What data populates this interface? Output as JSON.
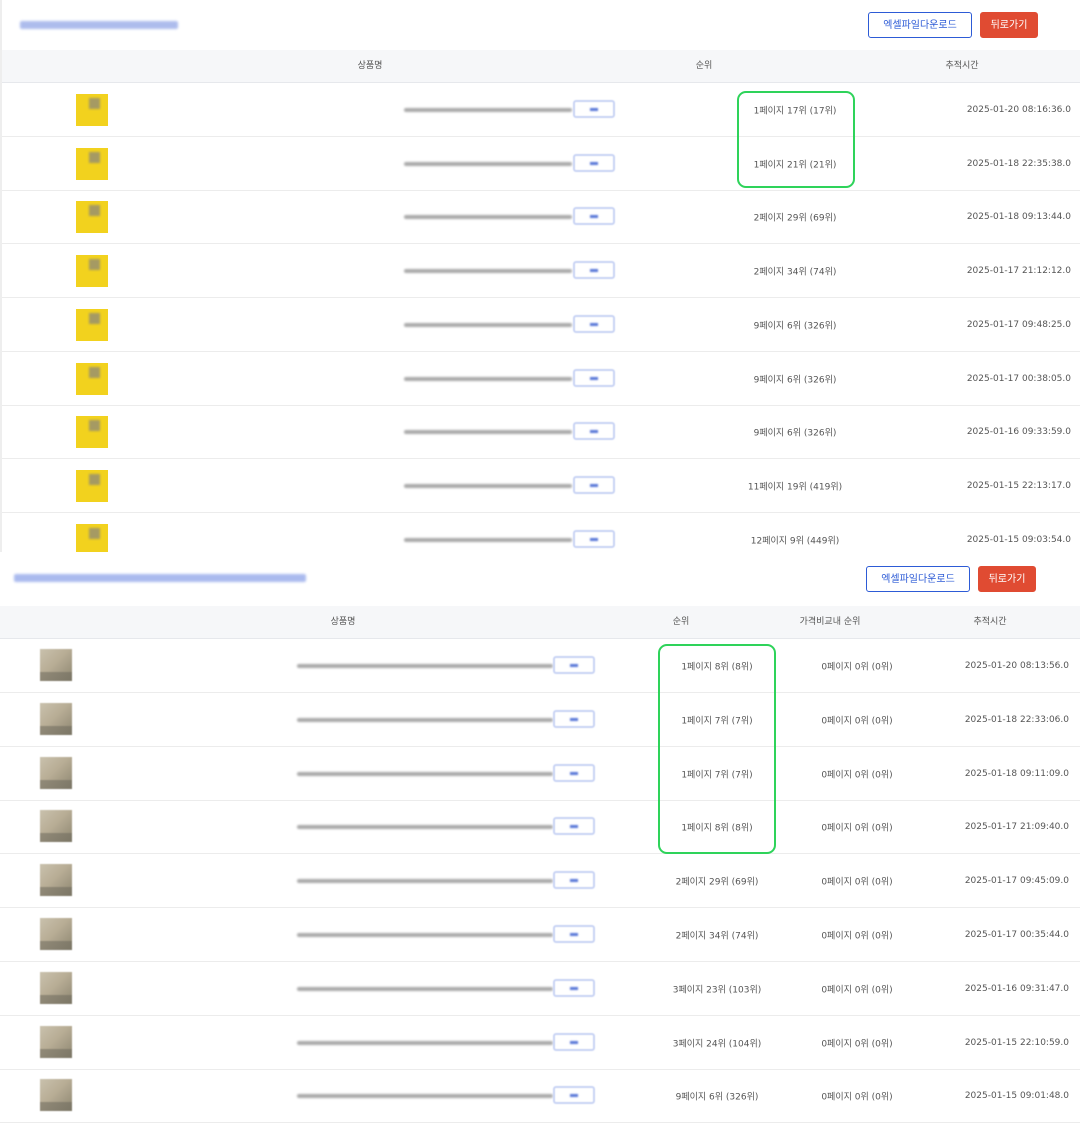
{
  "panel1": {
    "buttons": {
      "excel": "엑셀파일다운로드",
      "back": "뒤로가기"
    },
    "headers": {
      "product": "상품명",
      "rank": "순위",
      "time": "추적시간"
    },
    "rows": [
      {
        "rank": "1페이지 17위 (17위)",
        "time": "2025-01-20 08:16:36.0"
      },
      {
        "rank": "1페이지 21위 (21위)",
        "time": "2025-01-18 22:35:38.0"
      },
      {
        "rank": "2페이지 29위 (69위)",
        "time": "2025-01-18 09:13:44.0"
      },
      {
        "rank": "2페이지 34위 (74위)",
        "time": "2025-01-17 21:12:12.0"
      },
      {
        "rank": "9페이지 6위 (326위)",
        "time": "2025-01-17 09:48:25.0"
      },
      {
        "rank": "9페이지 6위 (326위)",
        "time": "2025-01-17 00:38:05.0"
      },
      {
        "rank": "9페이지 6위 (326위)",
        "time": "2025-01-16 09:33:59.0"
      },
      {
        "rank": "11페이지 19위 (419위)",
        "time": "2025-01-15 22:13:17.0"
      },
      {
        "rank": "12페이지 9위 (449위)",
        "time": "2025-01-15 09:03:54.0"
      }
    ]
  },
  "panel2": {
    "buttons": {
      "excel": "엑셀파일다운로드",
      "back": "뒤로가기"
    },
    "headers": {
      "product": "상품명",
      "rank": "순위",
      "compare_rank": "가격비교내 순위",
      "time": "추적시간"
    },
    "rows": [
      {
        "rank": "1페이지 8위 (8위)",
        "compare": "0페이지 0위 (0위)",
        "time": "2025-01-20 08:13:56.0"
      },
      {
        "rank": "1페이지 7위 (7위)",
        "compare": "0페이지 0위 (0위)",
        "time": "2025-01-18 22:33:06.0"
      },
      {
        "rank": "1페이지 7위 (7위)",
        "compare": "0페이지 0위 (0위)",
        "time": "2025-01-18 09:11:09.0"
      },
      {
        "rank": "1페이지 8위 (8위)",
        "compare": "0페이지 0위 (0위)",
        "time": "2025-01-17 21:09:40.0"
      },
      {
        "rank": "2페이지 29위 (69위)",
        "compare": "0페이지 0위 (0위)",
        "time": "2025-01-17 09:45:09.0"
      },
      {
        "rank": "2페이지 34위 (74위)",
        "compare": "0페이지 0위 (0위)",
        "time": "2025-01-17 00:35:44.0"
      },
      {
        "rank": "3페이지 23위 (103위)",
        "compare": "0페이지 0위 (0위)",
        "time": "2025-01-16 09:31:47.0"
      },
      {
        "rank": "3페이지 24위 (104위)",
        "compare": "0페이지 0위 (0위)",
        "time": "2025-01-15 22:10:59.0"
      },
      {
        "rank": "9페이지 6위 (326위)",
        "compare": "0페이지 0위 (0위)",
        "time": "2025-01-15 09:01:48.0"
      }
    ]
  },
  "colors": {
    "accent_blue": "#2d5bd6",
    "back_button_red": "#e04b32",
    "highlight_green": "#2ed35a",
    "thumb_yellow": "#f2d21e"
  }
}
